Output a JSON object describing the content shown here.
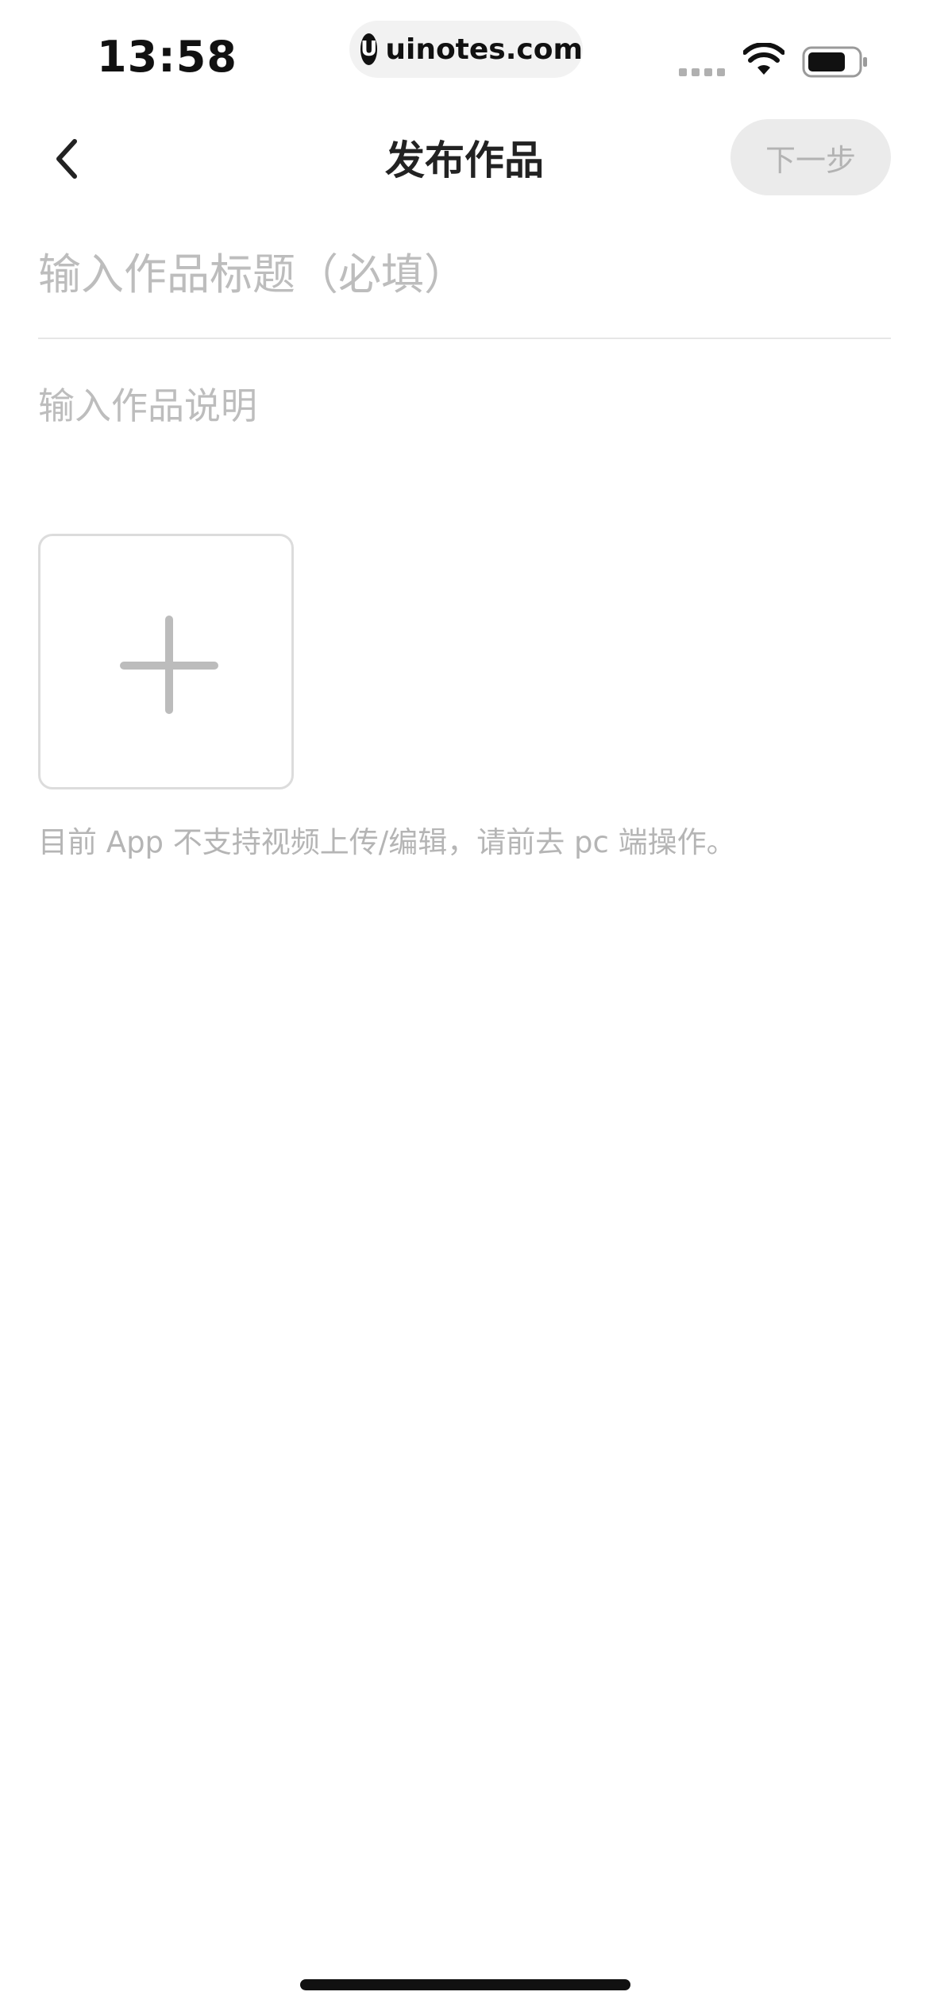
{
  "status_bar": {
    "time": "13:58",
    "url": "uinotes.com",
    "url_logo": "U",
    "icons": [
      "signal-icon",
      "wifi-icon",
      "battery-icon"
    ]
  },
  "nav": {
    "title": "发布作品",
    "next_label": "下一步",
    "back_icon": "chevron-left-icon"
  },
  "form": {
    "title_placeholder": "输入作品标题（必填）",
    "title_value": "",
    "description_placeholder": "输入作品说明",
    "description_value": "",
    "upload_icon": "plus-icon",
    "hint": "目前 App 不支持视频上传/编辑，请前去 pc 端操作。"
  },
  "colors": {
    "placeholder": "#bdbdbd",
    "disabled_button_bg": "#ebebeb",
    "disabled_button_text": "#b3b3b3",
    "border": "#dcdcdc"
  }
}
